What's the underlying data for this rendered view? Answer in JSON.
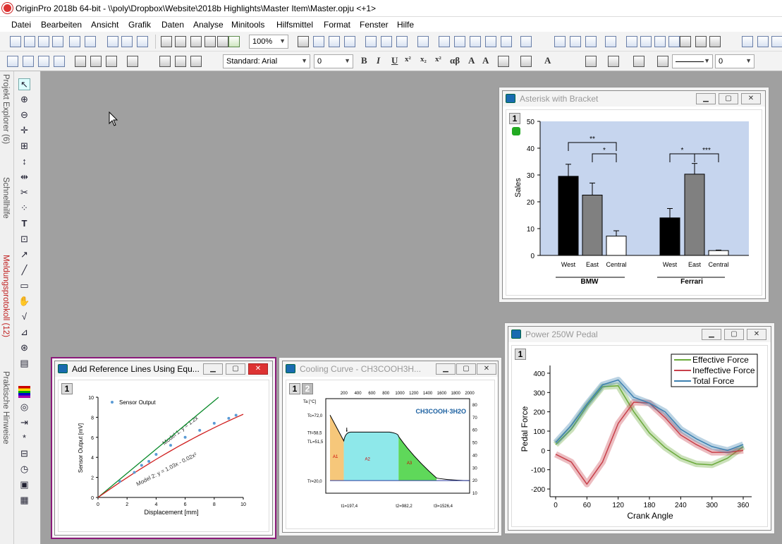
{
  "app": {
    "title": "OriginPro 2018b 64-bit - \\\\poly\\Dropbox\\Website\\2018b Highlights\\Master Item\\Master.opju <+1>"
  },
  "menu": [
    "Datei",
    "Bearbeiten",
    "Ansicht",
    "Grafik",
    "Daten",
    "Analyse",
    "Minitools",
    "Hilfsmittel",
    "Format",
    "Fenster",
    "Hilfe"
  ],
  "toolbar": {
    "zoom": "100%",
    "font": "Standard: Arial",
    "size": "0",
    "line_size": "0"
  },
  "sidetabs": [
    "Projekt Explorer (6)",
    "Schnellhilfe",
    "Meldungsprotokoll (12)",
    "Praktische Hinweise"
  ],
  "colors": {
    "accent": "#8b1a7a",
    "plot_bg": "#c6d5ee",
    "effective": "#6aaa3a",
    "ineffective": "#c8404a",
    "total": "#3c80b0"
  },
  "windows": {
    "asterisk": {
      "title": "Asterisk with Bracket",
      "layer": "1",
      "ylabel": "Sales",
      "yticks": [
        "0",
        "10",
        "20",
        "30",
        "40",
        "50"
      ],
      "groups": [
        "BMW",
        "Ferrari"
      ],
      "bar_labels": [
        "West",
        "East",
        "Central",
        "West",
        "East",
        "Central"
      ],
      "sig": [
        "**",
        "*",
        "*",
        "***"
      ]
    },
    "power": {
      "title": "Power 250W Pedal",
      "layer": "1",
      "xlabel": "Crank Angle",
      "ylabel": "Pedal Force",
      "xticks": [
        "0",
        "60",
        "120",
        "180",
        "240",
        "300",
        "360"
      ],
      "yticks": [
        "-200",
        "-100",
        "0",
        "100",
        "200",
        "300",
        "400"
      ],
      "legend": [
        "Effective Force",
        "Ineffective Force",
        "Total Force"
      ]
    },
    "reference": {
      "title": "Add Reference Lines Using Equ...",
      "layer": "1",
      "xlabel": "Displacement [mm]",
      "ylabel": "Sensor Output [mV]",
      "legend": "Sensor Output",
      "model1": "Model 1: y = 1.2x",
      "model2": "Model 2: y = 1.03x - 0.02x²",
      "xticks": [
        "0",
        "2",
        "4",
        "6",
        "8",
        "10"
      ],
      "yticks": [
        "0",
        "2",
        "4",
        "6",
        "8",
        "10"
      ]
    },
    "cooling": {
      "title": "Cooling Curve - CH3COOH3H...",
      "layers": [
        "1",
        "2"
      ],
      "formula": "CH3COOH·3H2O",
      "top_ticks": [
        "200",
        "400",
        "600",
        "800",
        "1000",
        "1200",
        "1400",
        "1600",
        "1800",
        "2000"
      ],
      "right_ticks": [
        "10",
        "20",
        "30",
        "40",
        "50",
        "60",
        "70",
        "80"
      ],
      "t_labels": [
        "Tc=72,0",
        "Tf=58,5",
        "TL=51,5",
        "Tr=20,0"
      ],
      "ylabel": "Ta [°C]",
      "tm": "tm",
      "x_labels": [
        "t1=197,4",
        "t2=982,2",
        "t3=1526,4"
      ],
      "areas": [
        "A1",
        "A2",
        "A3"
      ]
    }
  },
  "chart_data": [
    {
      "type": "bar",
      "title": "Asterisk with Bracket",
      "ylabel": "Sales",
      "ylim": [
        0,
        50
      ],
      "categories": [
        "West",
        "East",
        "Central",
        "West",
        "East",
        "Central"
      ],
      "groups": [
        "BMW",
        "Ferrari"
      ],
      "values": [
        29.5,
        22.5,
        7.2,
        14,
        30.3,
        1.8
      ],
      "errors": [
        4.5,
        4.5,
        2,
        3.5,
        4,
        0.2
      ],
      "colors": [
        "#000000",
        "#808080",
        "#ffffff",
        "#000000",
        "#808080",
        "#ffffff"
      ]
    },
    {
      "type": "line",
      "title": "Power 250W Pedal",
      "xlabel": "Crank Angle",
      "ylabel": "Pedal Force",
      "xlim": [
        -10,
        370
      ],
      "ylim": [
        -240,
        440
      ],
      "x": [
        0,
        30,
        60,
        90,
        120,
        150,
        180,
        210,
        240,
        270,
        300,
        330,
        360
      ],
      "series": [
        {
          "name": "Effective Force",
          "values": [
            30,
            110,
            230,
            330,
            335,
            200,
            90,
            15,
            -40,
            -70,
            -75,
            -40,
            20
          ]
        },
        {
          "name": "Ineffective Force",
          "values": [
            -20,
            -60,
            -175,
            -60,
            140,
            250,
            245,
            170,
            80,
            30,
            -10,
            -10,
            0
          ]
        },
        {
          "name": "Total Force",
          "values": [
            40,
            130,
            240,
            340,
            365,
            275,
            245,
            200,
            110,
            60,
            20,
            0,
            30
          ]
        }
      ]
    },
    {
      "type": "scatter",
      "title": "Add Reference Lines Using Equ...",
      "xlabel": "Displacement [mm]",
      "ylabel": "Sensor Output [mV]",
      "xlim": [
        0,
        10
      ],
      "ylim": [
        0,
        10
      ],
      "x": [
        1.5,
        2.5,
        3,
        3.5,
        4,
        5,
        6,
        7,
        8,
        9,
        9.5
      ],
      "values": [
        1.6,
        2.5,
        3.2,
        3.6,
        4.3,
        5.2,
        6,
        6.7,
        7.4,
        7.9,
        8.2
      ]
    },
    {
      "type": "area",
      "title": "Cooling Curve - CH3COOH3H...",
      "xlim": [
        0,
        2000
      ],
      "ylim": [
        0,
        80
      ],
      "x": [
        0,
        197.4,
        250,
        400,
        800,
        982.2,
        1200,
        1526.4,
        2000
      ],
      "values": [
        72,
        51.5,
        58.5,
        58.5,
        58.5,
        55,
        35,
        22,
        20
      ]
    }
  ]
}
